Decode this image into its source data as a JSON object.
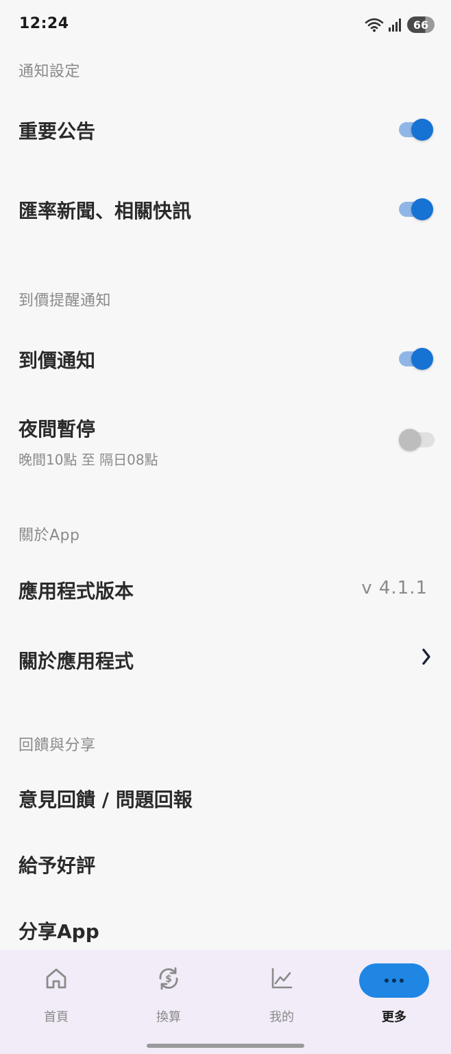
{
  "status_bar": {
    "time": "12:24",
    "battery": "66",
    "icons": [
      "wifi-icon",
      "signal-icon",
      "battery-icon"
    ]
  },
  "sections": {
    "notifications": {
      "header": "通知設定",
      "important": {
        "title": "重要公告",
        "enabled": true
      },
      "news": {
        "title": "匯率新聞、相關快訊",
        "enabled": true
      }
    },
    "price_alert": {
      "header": "到價提醒通知",
      "price_notify": {
        "title": "到價通知",
        "enabled": true
      },
      "night_pause": {
        "title": "夜間暫停",
        "subtitle": "晚間10點 至 隔日08點",
        "enabled": false
      }
    },
    "about": {
      "header": "關於App",
      "version": {
        "title": "應用程式版本",
        "value": "v 4.1.1"
      },
      "about_app": {
        "title": "關於應用程式"
      }
    },
    "feedback": {
      "header": "回饋與分享",
      "report": {
        "title": "意見回饋 / 問題回報"
      },
      "rate": {
        "title": "給予好評"
      },
      "share": {
        "title": "分享App"
      }
    }
  },
  "bottom_nav": {
    "items": [
      {
        "label": "首頁",
        "icon": "home-icon",
        "active": false
      },
      {
        "label": "換算",
        "icon": "currency-exchange-icon",
        "active": false
      },
      {
        "label": "我的",
        "icon": "chart-icon",
        "active": false
      },
      {
        "label": "更多",
        "icon": "more-icon",
        "active": true
      }
    ]
  },
  "colors": {
    "accent": "#1672d3",
    "toggle_track_on": "#8fb6e6",
    "nav_bg": "#f1ecf7",
    "active_pill": "#1f86e3"
  }
}
